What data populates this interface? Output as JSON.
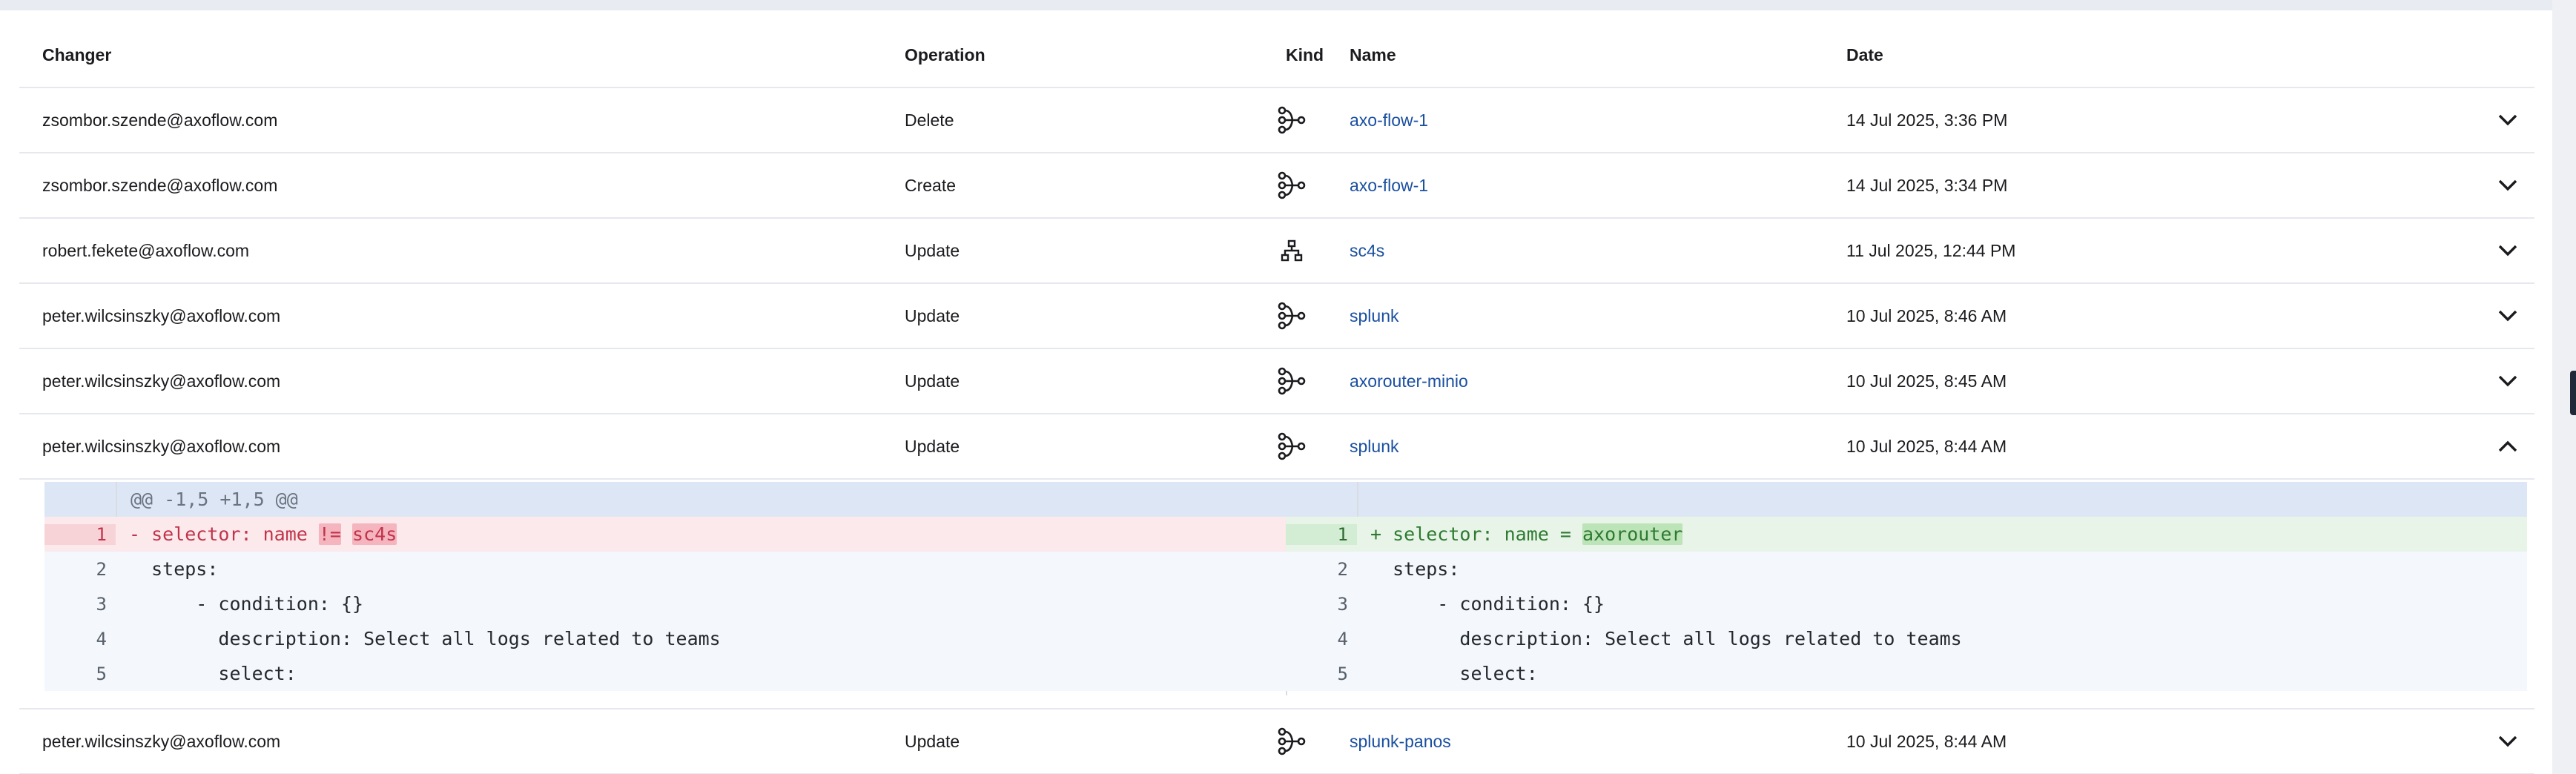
{
  "columns": {
    "changer": "Changer",
    "operation": "Operation",
    "kind": "Kind",
    "name": "Name",
    "date": "Date"
  },
  "rows": [
    {
      "changer": "zsombor.szende@axoflow.com",
      "operation": "Delete",
      "kind_icon": "flow-icon",
      "name": "axo-flow-1",
      "date": "14 Jul 2025, 3:36 PM",
      "expanded": false
    },
    {
      "changer": "zsombor.szende@axoflow.com",
      "operation": "Create",
      "kind_icon": "flow-icon",
      "name": "axo-flow-1",
      "date": "14 Jul 2025, 3:34 PM",
      "expanded": false
    },
    {
      "changer": "robert.fekete@axoflow.com",
      "operation": "Update",
      "kind_icon": "hierarchy-icon",
      "name": "sc4s",
      "date": "11 Jul 2025, 12:44 PM",
      "expanded": false
    },
    {
      "changer": "peter.wilcsinszky@axoflow.com",
      "operation": "Update",
      "kind_icon": "flow-icon",
      "name": "splunk",
      "date": "10 Jul 2025, 8:46 AM",
      "expanded": false
    },
    {
      "changer": "peter.wilcsinszky@axoflow.com",
      "operation": "Update",
      "kind_icon": "flow-icon",
      "name": "axorouter-minio",
      "date": "10 Jul 2025, 8:45 AM",
      "expanded": false
    },
    {
      "changer": "peter.wilcsinszky@axoflow.com",
      "operation": "Update",
      "kind_icon": "flow-icon",
      "name": "splunk",
      "date": "10 Jul 2025, 8:44 AM",
      "expanded": true
    },
    {
      "changer": "peter.wilcsinszky@axoflow.com",
      "operation": "Update",
      "kind_icon": "flow-icon",
      "name": "splunk-panos",
      "date": "10 Jul 2025, 8:44 AM",
      "expanded": false
    }
  ],
  "diff": {
    "hunk_header": "@@ -1,5 +1,5 @@",
    "left": {
      "line1": {
        "num": "1",
        "prefix": "- selector: name ",
        "hl1": "!=",
        "mid": " ",
        "hl2": "sc4s"
      },
      "line2": {
        "num": "2",
        "code": "  steps:"
      },
      "line3": {
        "num": "3",
        "code": "      - condition: {}"
      },
      "line4": {
        "num": "4",
        "code": "        description: Select all logs related to teams"
      },
      "line5": {
        "num": "5",
        "code": "        select:"
      }
    },
    "right": {
      "line1": {
        "num": "1",
        "prefix": "+ selector: name = ",
        "hl": "axorouter"
      },
      "line2": {
        "num": "2",
        "code": "  steps:"
      },
      "line3": {
        "num": "3",
        "code": "      - condition: {}"
      },
      "line4": {
        "num": "4",
        "code": "        description: Select all logs related to teams"
      },
      "line5": {
        "num": "5",
        "code": "        select:"
      }
    }
  },
  "colors": {
    "link": "#1a4fa0",
    "deletion": "#c2334a",
    "addition": "#2d7a30",
    "hunk_bg": "#dde6f5"
  }
}
